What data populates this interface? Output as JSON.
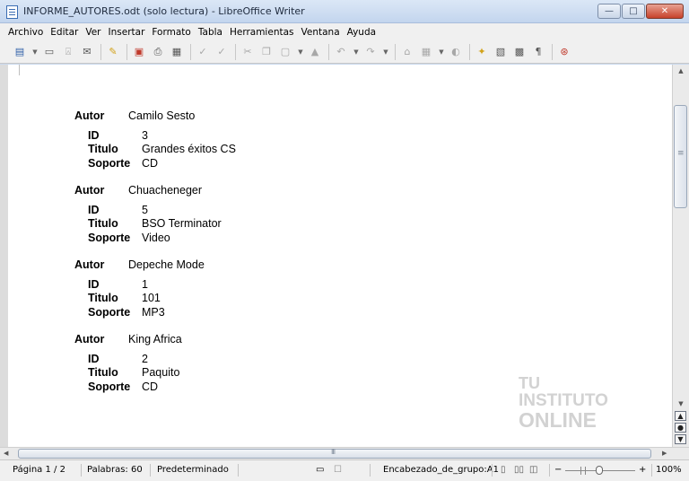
{
  "window": {
    "title": "INFORME_AUTORES.odt (solo lectura) - LibreOffice Writer",
    "minimize": "—",
    "restore": "□",
    "close": "✕"
  },
  "menu": {
    "items": [
      "Archivo",
      "Editar",
      "Ver",
      "Insertar",
      "Formato",
      "Tabla",
      "Herramientas",
      "Ventana",
      "Ayuda"
    ]
  },
  "toolbar": {
    "icons": [
      "new-document",
      "open",
      "save",
      "email",
      "edit-document",
      "export-pdf",
      "print",
      "print-preview",
      "spellcheck",
      "autocheck",
      "cut",
      "copy",
      "paste",
      "clone-format",
      "undo",
      "redo",
      "hyperlink",
      "table",
      "show-draw-functions",
      "navigator",
      "gallery",
      "data-sources",
      "formatting-marks",
      "help"
    ]
  },
  "document": {
    "groups": [
      {
        "autor_label": "Autor",
        "autor": "Camilo Sesto",
        "id_label": "ID",
        "id": "3",
        "titulo_label": "Titulo",
        "titulo": "Grandes éxitos CS",
        "soporte_label": "Soporte",
        "soporte": "CD"
      },
      {
        "autor_label": "Autor",
        "autor": "Chuacheneger",
        "id_label": "ID",
        "id": "5",
        "titulo_label": "Titulo",
        "titulo": "BSO Terminator",
        "soporte_label": "Soporte",
        "soporte": "Video"
      },
      {
        "autor_label": "Autor",
        "autor": "Depeche Mode",
        "id_label": "ID",
        "id": "1",
        "titulo_label": "Titulo",
        "titulo": "101",
        "soporte_label": "Soporte",
        "soporte": "MP3"
      },
      {
        "autor_label": "Autor",
        "autor": "King Africa",
        "id_label": "ID",
        "id": "2",
        "titulo_label": "Titulo",
        "titulo": "Paquito",
        "soporte_label": "Soporte",
        "soporte": "CD"
      }
    ],
    "watermark": {
      "line1": "TU",
      "line2": "INSTITUTO",
      "line3": "ONLINE"
    }
  },
  "statusbar": {
    "page": "Página 1 / 2",
    "words": "Palabras: 60",
    "style": "Predeterminado",
    "section": "Encabezado_de_grupo:A1",
    "zoom": "100%",
    "zoom_minus": "−",
    "zoom_plus": "+"
  },
  "scrollbar": {
    "h_mark": "III"
  }
}
